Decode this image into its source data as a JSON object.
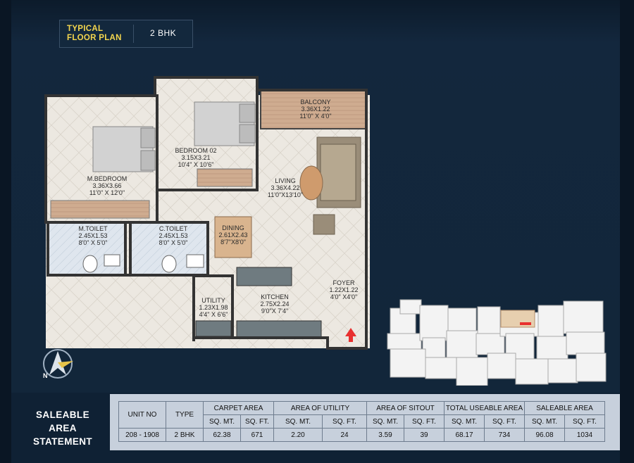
{
  "header": {
    "title_line1": "TYPICAL",
    "title_line2": "FLOOR PLAN",
    "unit_type": "2 BHK"
  },
  "rooms": [
    {
      "name": "BALCONY",
      "metric": "3.36X1.22",
      "imperial": "11'0\" X 4'0\""
    },
    {
      "name": "BEDROOM 02",
      "metric": "3.15X3.21",
      "imperial": "10'4\" X 10'6\""
    },
    {
      "name": "M.BEDROOM",
      "metric": "3.36X3.66",
      "imperial": "11'0\" X 12'0\""
    },
    {
      "name": "LIVING",
      "metric": "3.36X4.22",
      "imperial": "11'0\"X13'10\""
    },
    {
      "name": "M.TOILET",
      "metric": "2.45X1.53",
      "imperial": "8'0\" X 5'0\""
    },
    {
      "name": "C.TOILET",
      "metric": "2.45X1.53",
      "imperial": "8'0\" X 5'0\""
    },
    {
      "name": "DINING",
      "metric": "2.61X2.43",
      "imperial": "8'7\"X8'0\""
    },
    {
      "name": "UTILITY",
      "metric": "1.23X1.98",
      "imperial": "4'4\" X 6'6\""
    },
    {
      "name": "KITCHEN",
      "metric": "2.75X2.24",
      "imperial": "9'0\"X 7'4\""
    },
    {
      "name": "FOYER",
      "metric": "1.22X1.22",
      "imperial": "4'0\" X4'0\""
    }
  ],
  "compass": {
    "letter": "N",
    "icon": "north-compass-icon"
  },
  "statement": {
    "title_line1": "SALEABLE AREA",
    "title_line2": "STATEMENT",
    "headers": [
      "UNIT NO",
      "TYPE",
      "CARPET AREA",
      "AREA OF UTILITY",
      "AREA OF SITOUT",
      "TOTAL USEABLE AREA",
      "SALEABLE AREA"
    ],
    "sub": {
      "sqmt": "SQ. MT.",
      "sqft": "SQ. FT."
    },
    "row": {
      "unit_no": "208 - 1908",
      "type": "2 BHK",
      "carpet_sqmt": "62.38",
      "carpet_sqft": "671",
      "utility_sqmt": "2.20",
      "utility_sqft": "24",
      "sitout_sqmt": "3.59",
      "sitout_sqft": "39",
      "useable_sqmt": "68.17",
      "useable_sqft": "734",
      "saleable_sqmt": "96.08",
      "saleable_sqft": "1034"
    }
  },
  "colors": {
    "background": "#13273d",
    "title_accent": "#f4d64e",
    "floor": "#e9e4dc",
    "wood": "#c9a78a",
    "highlight": "#e8302f"
  }
}
